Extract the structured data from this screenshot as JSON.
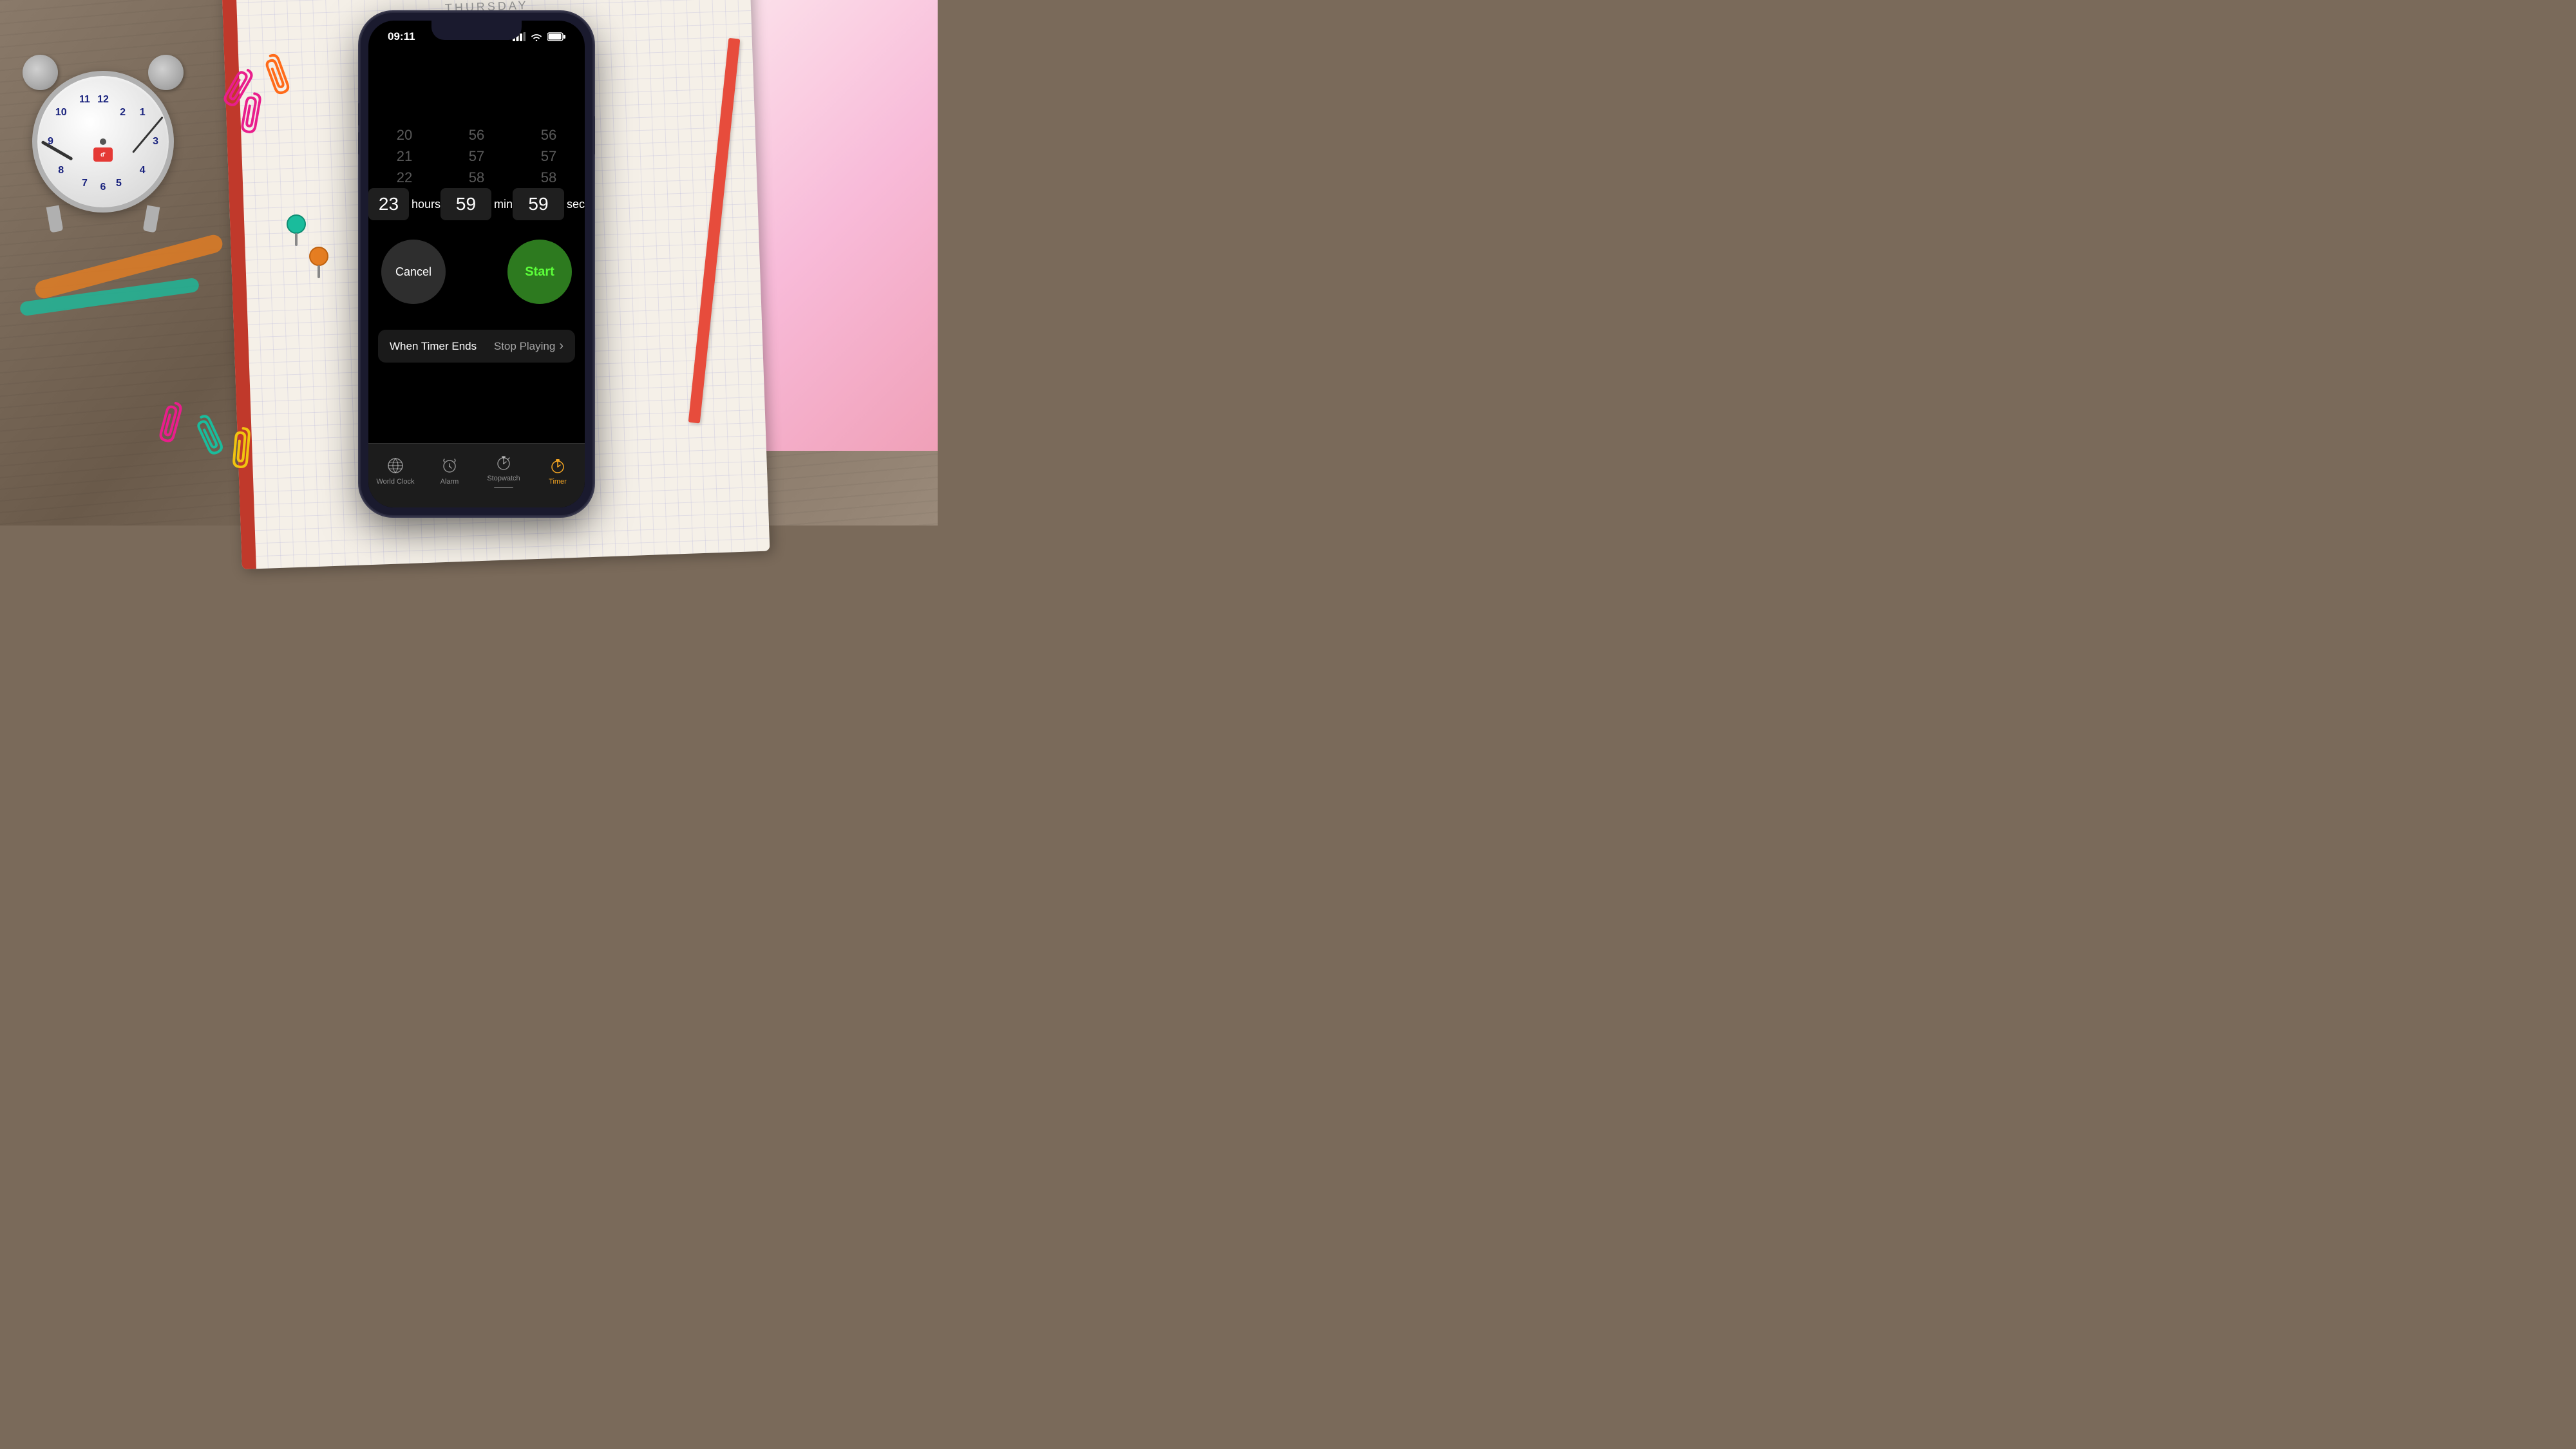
{
  "background": {
    "notebook_day": "THURSDAY"
  },
  "phone": {
    "status_bar": {
      "time": "09:11",
      "signal_bars": "▌▌▌",
      "wifi": "wifi",
      "battery": "battery"
    },
    "timer": {
      "hours_above": [
        "20",
        "21",
        "22"
      ],
      "hours_selected": "23",
      "hours_label": "hours",
      "minutes_above": [
        "56",
        "57",
        "58"
      ],
      "minutes_selected": "59",
      "minutes_label": "min",
      "seconds_above": [
        "56",
        "57",
        "58"
      ],
      "seconds_selected": "59",
      "seconds_label": "sec"
    },
    "buttons": {
      "cancel": "Cancel",
      "start": "Start"
    },
    "timer_ends": {
      "label": "When Timer Ends",
      "value": "Stop Playing",
      "chevron": "›"
    },
    "tabs": [
      {
        "id": "world-clock",
        "label": "World Clock",
        "icon": "globe",
        "active": false
      },
      {
        "id": "alarm",
        "label": "Alarm",
        "icon": "alarm",
        "active": false
      },
      {
        "id": "stopwatch",
        "label": "Stopwatch",
        "icon": "stopwatch",
        "active": false
      },
      {
        "id": "timer",
        "label": "Timer",
        "icon": "timer",
        "active": true
      }
    ]
  },
  "colors": {
    "start_button": "#2d7a1f",
    "start_text": "#5cff3a",
    "cancel_button": "rgba(255,255,255,0.18)",
    "tab_active": "#f5a623",
    "tab_inactive": "rgba(255,255,255,0.5)"
  }
}
